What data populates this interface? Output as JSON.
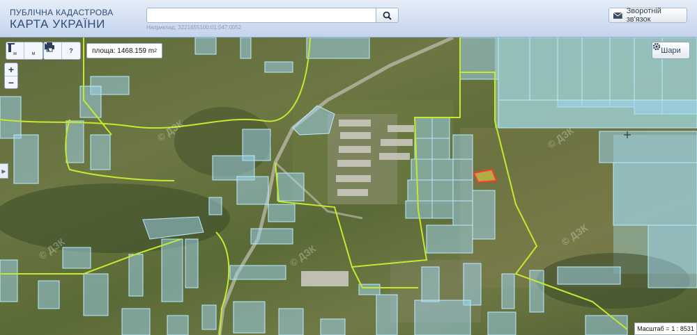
{
  "header": {
    "logo_line1": "ПУБЛІЧНА КАДАСТРОВА",
    "logo_line2": "КАРТА УКРАЇНИ",
    "search_value": "",
    "search_hint": "Наприклад: 3221655100:01:047:0052",
    "feedback_label": "Зворотній зв'язок"
  },
  "map": {
    "tools": [
      {
        "name": "measure-line-tool",
        "label": "м"
      },
      {
        "name": "measure-area-tool",
        "label": "м"
      },
      {
        "name": "print-tool"
      },
      {
        "name": "info-tool",
        "label": "?"
      }
    ],
    "area_label": "площа: 1468.159 m",
    "area_unit_sup": "2",
    "zoom_in": "+",
    "zoom_out": "−",
    "side_toggle": "▶",
    "layers_label": "Шари",
    "scale_label": "Масштаб =",
    "scale_value": "1 : 8531",
    "watermark": "© ДЗК",
    "colors": {
      "parcel_fill": "#9fd6f2",
      "parcel_stroke": "#aee6ff",
      "boundary_line": "#c4ea2f",
      "selected_parcel": "#ff3b2f"
    }
  }
}
